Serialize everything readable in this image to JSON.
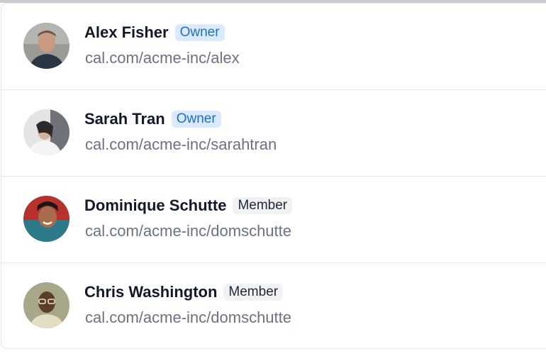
{
  "members": [
    {
      "name": "Alex Fisher",
      "role": "Owner",
      "role_type": "owner",
      "url": "cal.com/acme-inc/alex",
      "avatar_icon": "avatar-photo-alex"
    },
    {
      "name": "Sarah Tran",
      "role": "Owner",
      "role_type": "owner",
      "url": "cal.com/acme-inc/sarahtran",
      "avatar_icon": "avatar-photo-sarah"
    },
    {
      "name": "Dominique Schutte",
      "role": "Member",
      "role_type": "member",
      "url": "cal.com/acme-inc/domschutte",
      "avatar_icon": "avatar-photo-dominique"
    },
    {
      "name": "Chris Washington",
      "role": "Member",
      "role_type": "member",
      "url": "cal.com/acme-inc/domschutte",
      "avatar_icon": "avatar-photo-chris"
    }
  ],
  "colors": {
    "owner_badge_bg": "#dbeafe",
    "owner_badge_text": "#1d6fc4",
    "member_badge_bg": "#f1f2f4",
    "member_badge_text": "#1f2937"
  }
}
